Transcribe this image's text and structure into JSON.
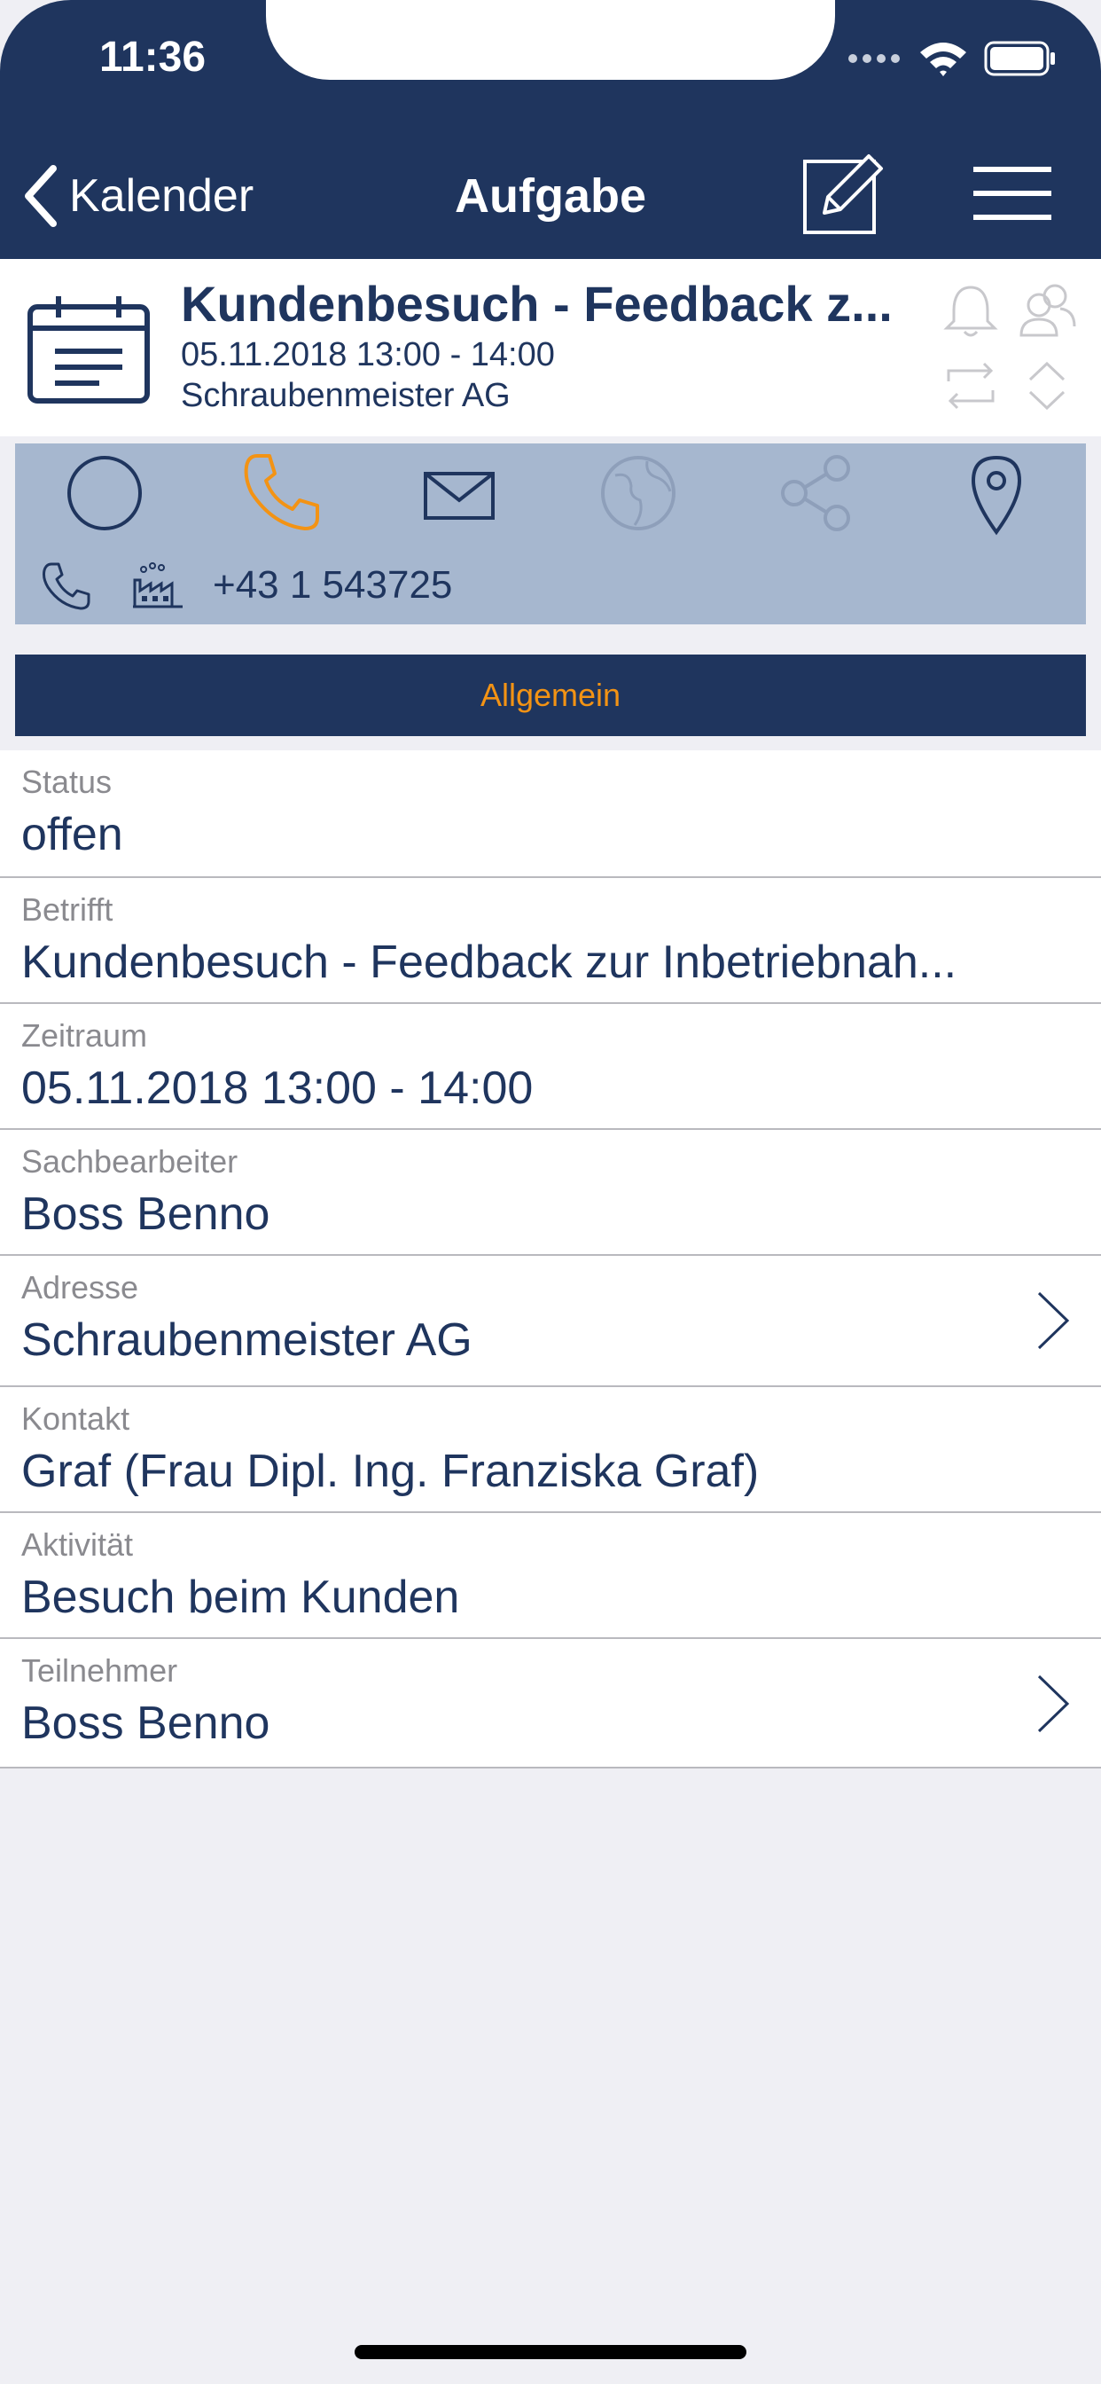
{
  "status_bar": {
    "time": "11:36"
  },
  "nav": {
    "back_label": "Kalender",
    "title": "Aufgabe"
  },
  "task": {
    "title": "Kundenbesuch - Feedback z...",
    "datetime": "05.11.2018 13:00 - 14:00",
    "company": "Schraubenmeister AG"
  },
  "actions": {
    "phone_number": "+43 1 543725"
  },
  "section": {
    "label": "Allgemein"
  },
  "fields": [
    {
      "label": "Status",
      "value": "offen"
    },
    {
      "label": "Betrifft",
      "value": "Kundenbesuch - Feedback zur Inbetriebnah..."
    },
    {
      "label": "Zeitraum",
      "value": "05.11.2018 13:00 - 14:00"
    },
    {
      "label": "Sachbearbeiter",
      "value": "Boss Benno"
    },
    {
      "label": "Adresse",
      "value": "Schraubenmeister AG"
    },
    {
      "label": "Kontakt",
      "value": "Graf (Frau Dipl. Ing. Franziska Graf)"
    },
    {
      "label": "Aktivität",
      "value": "Besuch beim Kunden"
    },
    {
      "label": "Teilnehmer",
      "value": "Boss Benno"
    }
  ],
  "colors": {
    "navy": "#1f355e",
    "accent_orange": "#f39314",
    "action_bar": "#a6b7cf",
    "background": "#efeff4"
  }
}
